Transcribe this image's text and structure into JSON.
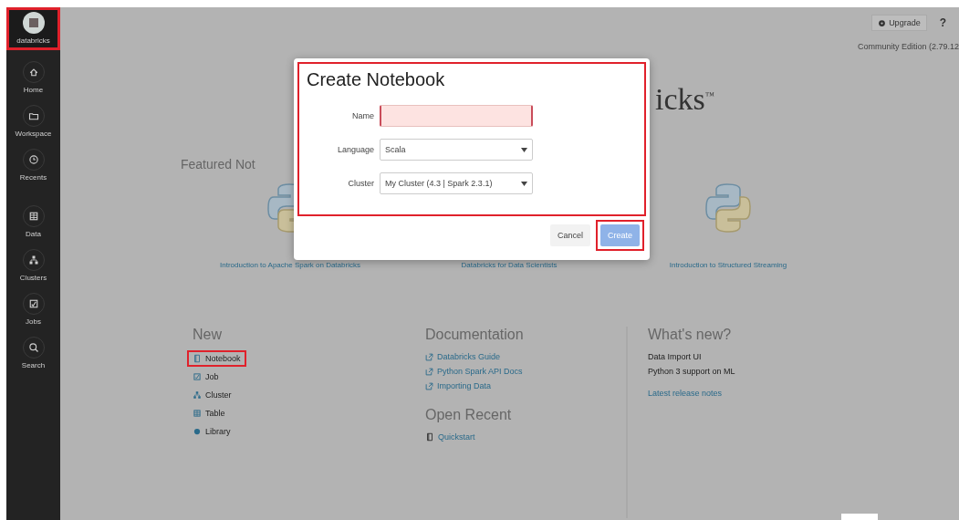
{
  "sidebar": {
    "logo_label": "databricks",
    "highlighted": true,
    "items": [
      {
        "label": "Home"
      },
      {
        "label": "Workspace"
      },
      {
        "label": "Recents"
      },
      {
        "label": "Data"
      },
      {
        "label": "Clusters"
      },
      {
        "label": "Jobs"
      },
      {
        "label": "Search"
      }
    ]
  },
  "topbar": {
    "upgrade": "Upgrade",
    "help": "?",
    "edition": "Community Edition (2.79.12"
  },
  "brand": "icks",
  "brand_mark": "™",
  "featured": {
    "title": "Featured Not",
    "notebooks": [
      {
        "label": "Introduction to Apache Spark on Databricks"
      },
      {
        "label": "Databricks for Data Scientists"
      },
      {
        "label": "Introduction to Structured Streaming"
      }
    ]
  },
  "new": {
    "title": "New",
    "items": [
      {
        "label": "Notebook",
        "highlighted": true
      },
      {
        "label": "Job",
        "highlighted": false
      },
      {
        "label": "Cluster",
        "highlighted": false
      },
      {
        "label": "Table",
        "highlighted": false
      },
      {
        "label": "Library",
        "highlighted": false
      }
    ]
  },
  "documentation": {
    "title": "Documentation",
    "links": [
      {
        "label": "Databricks Guide"
      },
      {
        "label": "Python Spark API Docs"
      },
      {
        "label": "Importing Data"
      }
    ]
  },
  "open_recent": {
    "title": "Open Recent",
    "items": [
      {
        "label": "Quickstart"
      }
    ]
  },
  "whats_new": {
    "title": "What's new?",
    "items": [
      "Data Import UI",
      "Python 3 support on ML"
    ],
    "link": "Latest release notes"
  },
  "dialog": {
    "title": "Create Notebook",
    "form_highlighted": true,
    "fields": [
      {
        "label": "Name",
        "kind": "text",
        "invalid": true
      },
      {
        "label": "Language",
        "kind": "select",
        "value": "Scala",
        "invalid": false
      },
      {
        "label": "Cluster",
        "kind": "select",
        "value": "My Cluster (4.3 | Spark 2.3.1)",
        "invalid": false
      }
    ],
    "cancel": "Cancel",
    "create": "Create",
    "create_highlighted": true
  }
}
